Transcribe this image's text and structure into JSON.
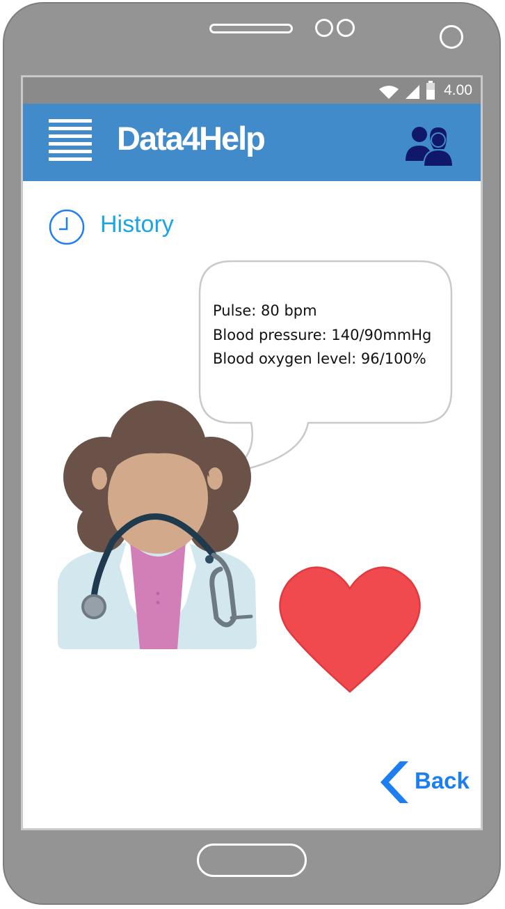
{
  "status_bar": {
    "time": "4.00",
    "icons": [
      "wifi-icon",
      "signal-icon",
      "battery-icon"
    ]
  },
  "app_bar": {
    "title": "Data4Help",
    "menu_icon": "hamburger-menu-icon",
    "people_icon": "people-icon",
    "color": "#428bcb"
  },
  "history": {
    "label": "History",
    "icon": "clock-icon",
    "color": "#1ca3e8"
  },
  "vitals": {
    "pulse": "Pulse: 80 bpm",
    "blood_pressure": "Blood pressure: 140/90mmHg",
    "blood_oxygen": "Blood oxygen level: 96/100%"
  },
  "illustration": {
    "doctor": "doctor-avatar",
    "heart": "heart-icon",
    "heart_color": "#f04a4f"
  },
  "navigation": {
    "back_label": "Back",
    "back_color": "#1c7ef0"
  }
}
